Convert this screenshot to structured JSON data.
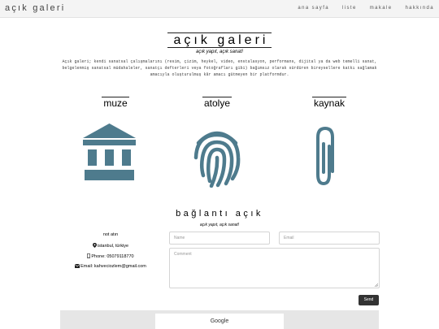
{
  "navbar": {
    "brand": "açık galeri",
    "links": [
      "ana sayfa",
      "liste",
      "makale",
      "hakkında"
    ]
  },
  "hero": {
    "title": "açık galeri",
    "subtitle": "açık yapıt, açık sanat!",
    "description": "Açık galeri; kendi sanatsal çalışmalarını (resim, çizim, heykel, video, enstalasyon, performans, dijital ya da web temelli sanat, belgelenmiş sanatsal müdahaleler, sanatçı defterleri veya fotoğrafları gibi) bağımsız olarak sürdüren bireysellere katkı sağlamak amacıyla oluşturulmuş kâr amacı gütmeyen bir platformdur."
  },
  "columns": [
    {
      "label": "muze",
      "icon": "museum-icon"
    },
    {
      "label": "atolye",
      "icon": "fingerprint-icon"
    },
    {
      "label": "kaynak",
      "icon": "paperclip-icon"
    }
  ],
  "contact": {
    "title": "bağlantı açık",
    "subtitle": "açık yapıt, açık sanat!",
    "name": "not atın",
    "location": "istanbul, türkiye",
    "phone": "Phone: 05079118770",
    "email": "Email: kahveciozlem@gmail.com"
  },
  "form": {
    "name_placeholder": "Name",
    "email_placeholder": "Email",
    "comment_placeholder": "Comment",
    "send_label": "Send"
  },
  "map": {
    "label": "Google"
  },
  "colors": {
    "icon": "#4e7b8d",
    "accent": "#333333"
  }
}
